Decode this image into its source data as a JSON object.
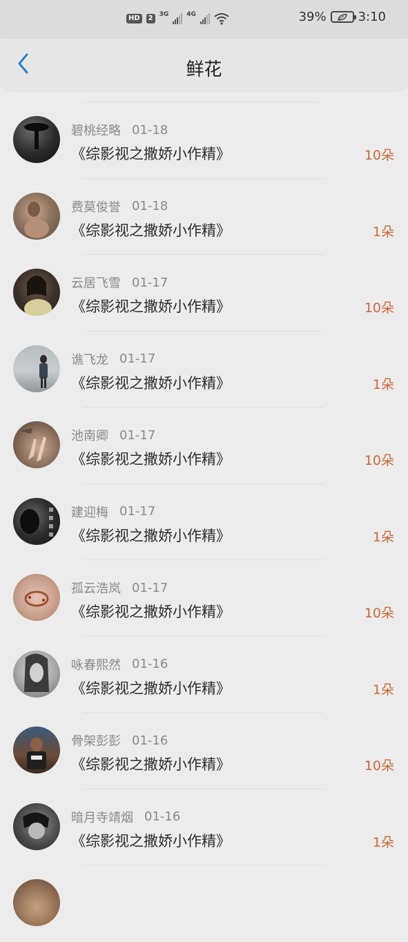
{
  "status_bar": {
    "hd_label": "HD",
    "sim_label": "2",
    "net1": "3G",
    "net2": "4G",
    "battery": "39%",
    "time": "3:10"
  },
  "header": {
    "title": "鲜花",
    "back_icon": "chevron-left-icon",
    "accent_color": "#2f7fc1"
  },
  "items": [
    {
      "name": "碧桃经略",
      "date": "01-18",
      "book": "《综影视之撒娇小作精》",
      "count": "10朵"
    },
    {
      "name": "费莫俊誉",
      "date": "01-18",
      "book": "《综影视之撒娇小作精》",
      "count": "1朵"
    },
    {
      "name": "云居飞雪",
      "date": "01-17",
      "book": "《综影视之撒娇小作精》",
      "count": "10朵"
    },
    {
      "name": "谯飞龙",
      "date": "01-17",
      "book": "《综影视之撒娇小作精》",
      "count": "1朵"
    },
    {
      "name": "池南卿",
      "date": "01-17",
      "book": "《综影视之撒娇小作精》",
      "count": "10朵"
    },
    {
      "name": "建迎梅",
      "date": "01-17",
      "book": "《综影视之撒娇小作精》",
      "count": "1朵"
    },
    {
      "name": "孤云浩岚",
      "date": "01-17",
      "book": "《综影视之撒娇小作精》",
      "count": "10朵"
    },
    {
      "name": "咏春熙然",
      "date": "01-16",
      "book": "《综影视之撒娇小作精》",
      "count": "1朵"
    },
    {
      "name": "骨架彭彭",
      "date": "01-16",
      "book": "《综影视之撒娇小作精》",
      "count": "10朵"
    },
    {
      "name": "暗月寺靖烟",
      "date": "01-16",
      "book": "《综影视之撒娇小作精》",
      "count": "1朵"
    }
  ]
}
